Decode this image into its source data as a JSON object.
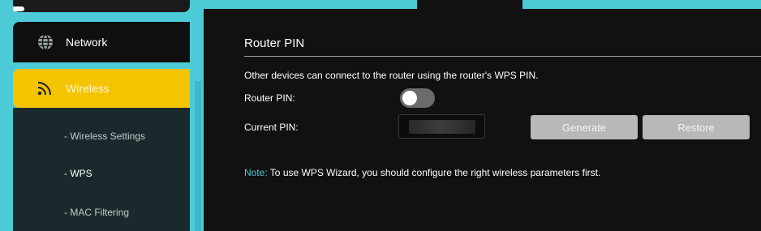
{
  "sidebar": {
    "items": [
      {
        "label": "Network",
        "icon": "globe-icon"
      },
      {
        "label": "Wireless",
        "icon": "wifi-icon"
      }
    ],
    "submenu": [
      {
        "label": "- Wireless Settings"
      },
      {
        "label": "- WPS"
      },
      {
        "label": "- MAC Filtering"
      }
    ]
  },
  "main": {
    "section_title": "Router PIN",
    "description": "Other devices can connect to the router using the router's WPS PIN.",
    "router_pin": {
      "label": "Router PIN:",
      "enabled": false
    },
    "current_pin": {
      "label": "Current PIN:",
      "value": ""
    },
    "buttons": {
      "generate": "Generate",
      "restore": "Restore"
    },
    "note": {
      "label": "Note:",
      "text": " To use WPS Wizard, you should configure the right wireless parameters first."
    }
  },
  "colors": {
    "accent": "#f5c400",
    "teal": "#4ccad6",
    "background": "#111111",
    "button": "#b8b8b8"
  }
}
